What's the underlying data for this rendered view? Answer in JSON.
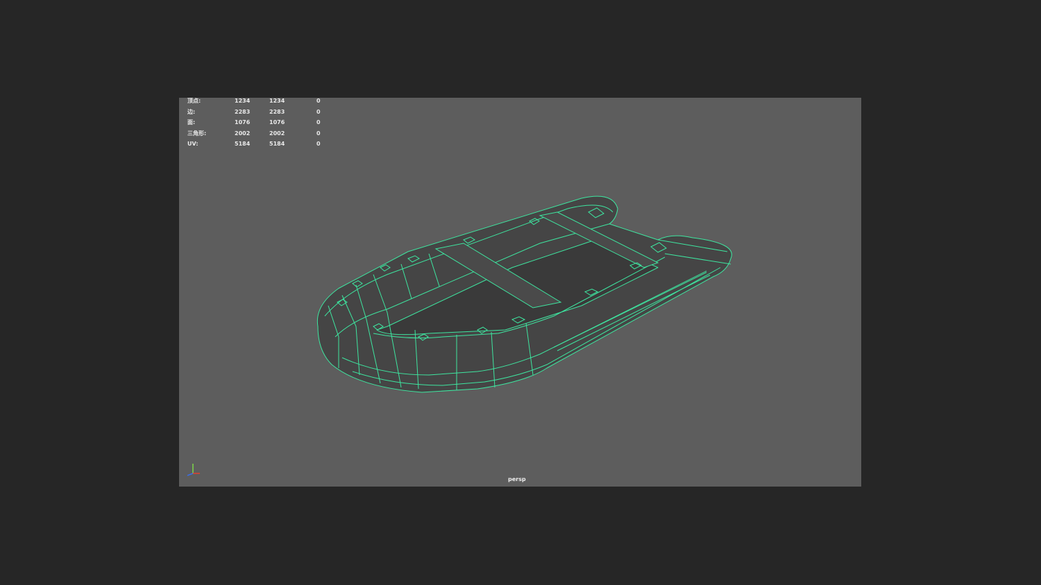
{
  "hud": {
    "rows": [
      {
        "label": "顶点:",
        "v1": "1234",
        "v2": "1234",
        "v3": "0"
      },
      {
        "label": "边:",
        "v1": "2283",
        "v2": "2283",
        "v3": "0"
      },
      {
        "label": "面:",
        "v1": "1076",
        "v2": "1076",
        "v3": "0"
      },
      {
        "label": "三角形:",
        "v1": "2002",
        "v2": "2002",
        "v3": "0"
      },
      {
        "label": "UV:",
        "v1": "5184",
        "v2": "5184",
        "v3": "0"
      }
    ]
  },
  "viewport": {
    "camera": "persp"
  },
  "colors": {
    "background": "#262626",
    "viewport": "#5d5d5d",
    "wireframe": "#3ee6a0",
    "mesh": "#444444"
  },
  "icons": {
    "axis": "xyz-axis-gizmo-icon"
  }
}
